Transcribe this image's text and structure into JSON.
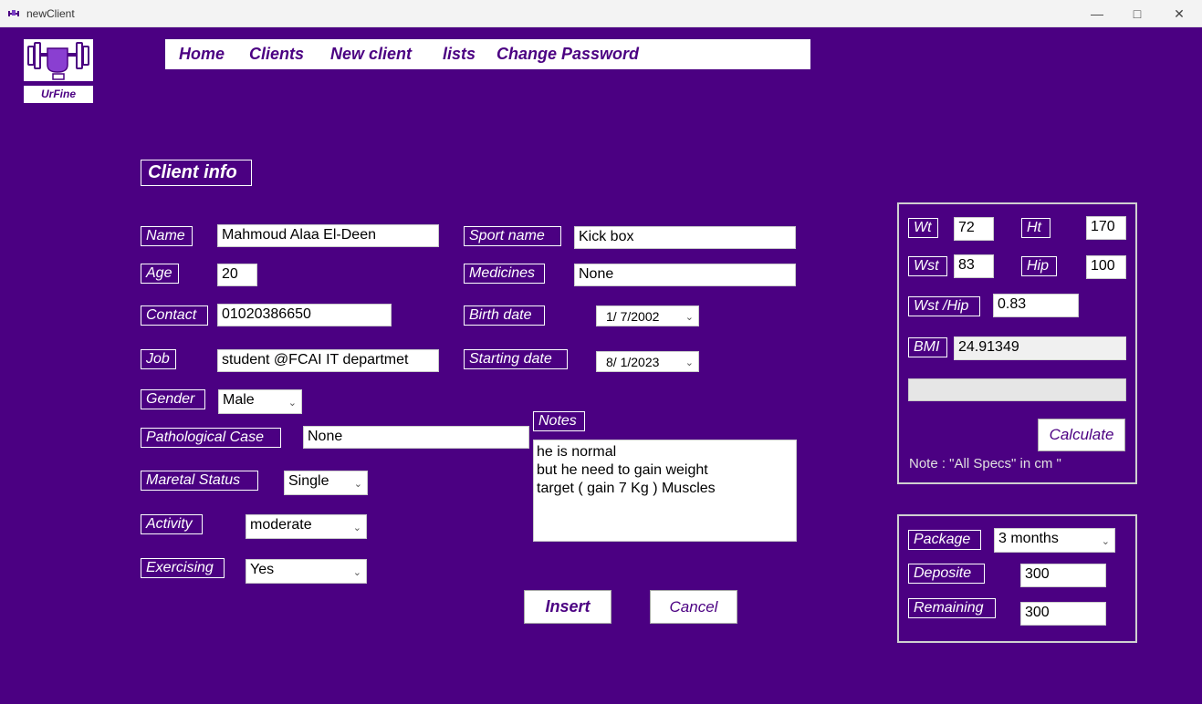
{
  "window": {
    "title": "newClient",
    "minimize_icon": "minimize-icon",
    "maximize_icon": "maximize-icon",
    "close_icon": "close-icon"
  },
  "logo": {
    "label": "UrFine",
    "icon": "dumbbell-fist-icon"
  },
  "nav": {
    "items": [
      "Home",
      "Clients",
      "New client",
      "lists",
      "Change Password"
    ]
  },
  "section_title": "Client info",
  "form": {
    "name": {
      "label": "Name",
      "value": "Mahmoud Alaa El-Deen"
    },
    "age": {
      "label": "Age",
      "value": "20"
    },
    "contact": {
      "label": "Contact",
      "value": "01020386650"
    },
    "job": {
      "label": "Job",
      "value": "student @FCAI IT departmet"
    },
    "gender": {
      "label": "Gender",
      "value": "Male"
    },
    "pathological": {
      "label": "Pathological Case",
      "value": "None"
    },
    "marital": {
      "label": "Maretal Status",
      "value": "Single"
    },
    "activity": {
      "label": "Activity",
      "value": "moderate"
    },
    "exercising": {
      "label": "Exercising",
      "value": "Yes"
    },
    "sport": {
      "label": "Sport name",
      "value": "Kick box"
    },
    "medicines": {
      "label": "Medicines",
      "value": "None"
    },
    "birth_date": {
      "label": "Birth date",
      "value": "1/ 7/2002"
    },
    "start_date": {
      "label": "Starting date",
      "value": "8/ 1/2023"
    },
    "notes": {
      "label": "Notes",
      "lines": [
        "he is normal",
        "but he need to gain weight",
        "target ( gain 7 Kg ) Muscles"
      ]
    }
  },
  "actions": {
    "insert": "Insert",
    "cancel": "Cancel"
  },
  "specs": {
    "wt": {
      "label": "Wt",
      "value": "72"
    },
    "ht": {
      "label": "Ht",
      "value": "170"
    },
    "wst": {
      "label": "Wst",
      "value": "83"
    },
    "hip": {
      "label": "Hip",
      "value": "100"
    },
    "wst_hip": {
      "label": "Wst /Hip",
      "value": "0.83"
    },
    "bmi": {
      "label": "BMI",
      "value": "24.91349"
    },
    "calculate": "Calculate",
    "note": "Note : \"All Specs\" in cm \""
  },
  "package": {
    "package": {
      "label": "Package",
      "value": "3 months"
    },
    "deposite": {
      "label": "Deposite",
      "value": "300"
    },
    "remaining": {
      "label": "Remaining",
      "value": "300"
    }
  }
}
